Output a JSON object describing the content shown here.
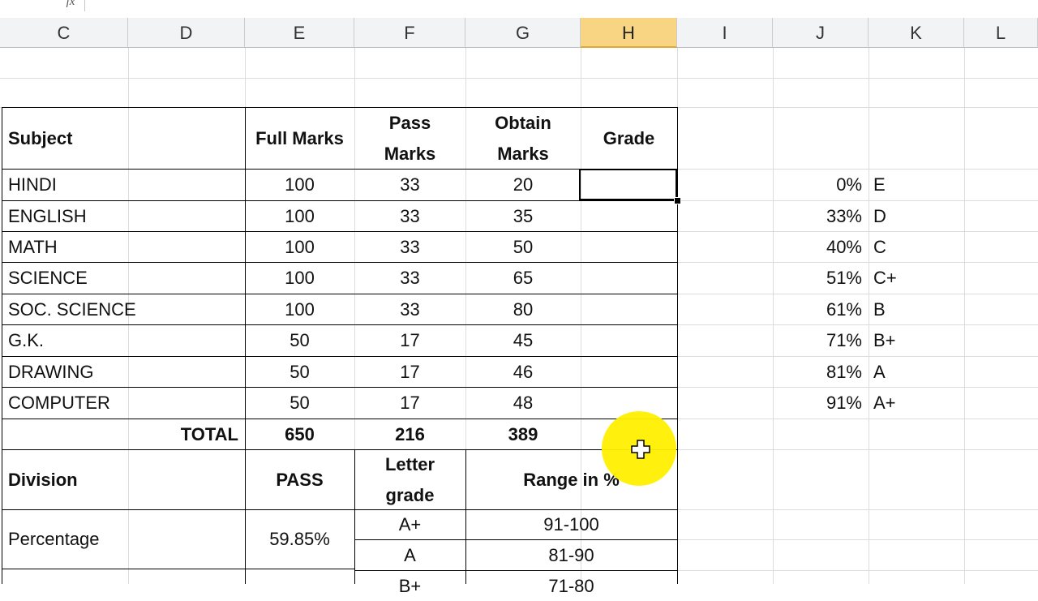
{
  "formula_bar": {
    "fx_label": "fx"
  },
  "columns": [
    "C",
    "D",
    "E",
    "F",
    "G",
    "H",
    "I",
    "J",
    "K",
    "L"
  ],
  "selected_column": "H",
  "marks_table": {
    "headers": {
      "subject": "Subject",
      "full_marks": "Full Marks",
      "pass_marks_1": "Pass",
      "pass_marks_2": "Marks",
      "obtain_marks_1": "Obtain",
      "obtain_marks_2": "Marks",
      "grade": "Grade"
    },
    "rows": [
      {
        "subject": "HINDI",
        "full": "100",
        "pass": "33",
        "obtain": "20"
      },
      {
        "subject": "ENGLISH",
        "full": "100",
        "pass": "33",
        "obtain": "35"
      },
      {
        "subject": "MATH",
        "full": "100",
        "pass": "33",
        "obtain": "50"
      },
      {
        "subject": "SCIENCE",
        "full": "100",
        "pass": "33",
        "obtain": "65"
      },
      {
        "subject": "SOC. SCIENCE",
        "full": "100",
        "pass": "33",
        "obtain": "80"
      },
      {
        "subject": "G.K.",
        "full": "50",
        "pass": "17",
        "obtain": "45"
      },
      {
        "subject": "DRAWING",
        "full": "50",
        "pass": "17",
        "obtain": "46"
      },
      {
        "subject": "COMPUTER",
        "full": "50",
        "pass": "17",
        "obtain": "48"
      }
    ],
    "total": {
      "label": "TOTAL",
      "full": "650",
      "pass": "216",
      "obtain": "389"
    }
  },
  "division_table": {
    "division_label": "Division",
    "pass_label": "PASS",
    "letter_grade_1": "Letter",
    "letter_grade_2": "grade",
    "range_label": "Range in %",
    "percentage_label": "Percentage",
    "percentage_value": "59.85%",
    "grade_rows": [
      {
        "grade": "A+",
        "range": "91-100"
      },
      {
        "grade": "A",
        "range": "81-90"
      },
      {
        "grade": "B+",
        "range": "71-80"
      }
    ]
  },
  "lookup_table": [
    {
      "pct": "0%",
      "grade": "E"
    },
    {
      "pct": "33%",
      "grade": "D"
    },
    {
      "pct": "40%",
      "grade": "C"
    },
    {
      "pct": "51%",
      "grade": "C+"
    },
    {
      "pct": "61%",
      "grade": "B"
    },
    {
      "pct": "71%",
      "grade": "B+"
    },
    {
      "pct": "81%",
      "grade": "A"
    },
    {
      "pct": "91%",
      "grade": "A+"
    }
  ]
}
